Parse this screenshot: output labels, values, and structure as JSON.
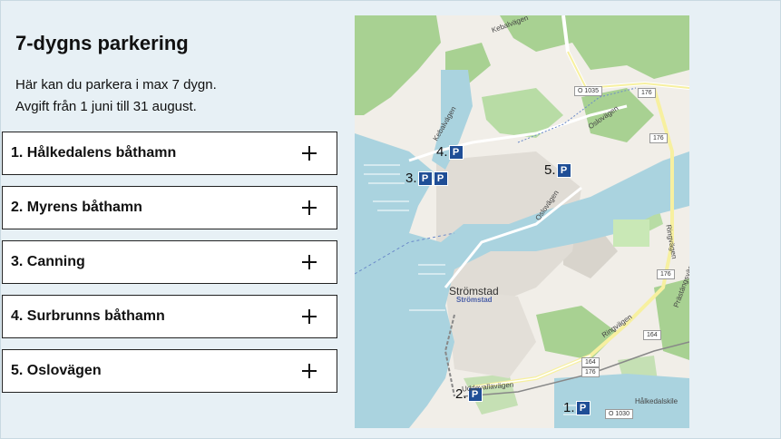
{
  "page": {
    "title": "7-dygns parkering",
    "lines": [
      "Här kan du parkera i max 7 dygn.",
      "Avgift från 1 juni till 31 august."
    ]
  },
  "accordion": [
    {
      "label": "1. Hålkedalens båthamn"
    },
    {
      "label": "2. Myrens båthamn"
    },
    {
      "label": "3. Canning"
    },
    {
      "label": "4. Surbrunns båthamn"
    },
    {
      "label": "5. Oslovägen"
    }
  ],
  "map": {
    "markers": [
      {
        "num": "1.",
        "icon": "P"
      },
      {
        "num": "2.",
        "icon": "P"
      },
      {
        "num": "3.",
        "icon": "P",
        "icon2": "P"
      },
      {
        "num": "4.",
        "icon": "P"
      },
      {
        "num": "5.",
        "icon": "P"
      }
    ],
    "labels": {
      "city": "Strömstad",
      "city_sub": "Strömstad",
      "kebal": "Kebalvägen",
      "oslo1": "Oslovägen",
      "oslo2": "Oslovägen",
      "uddev": "Uddevallavägen",
      "ring1": "Ringvägen",
      "ring2": "Ringvägen",
      "prast": "Prästängsvägen",
      "halk": "Hålkedalskile",
      "kebal2": "Kebalvägen"
    },
    "shields": {
      "o1035": "O 1035",
      "r176a": "176",
      "r176b": "176",
      "r176c": "176",
      "r164a": "164",
      "r164b": "164",
      "r164c": "176",
      "o1030": "O 1030"
    }
  }
}
